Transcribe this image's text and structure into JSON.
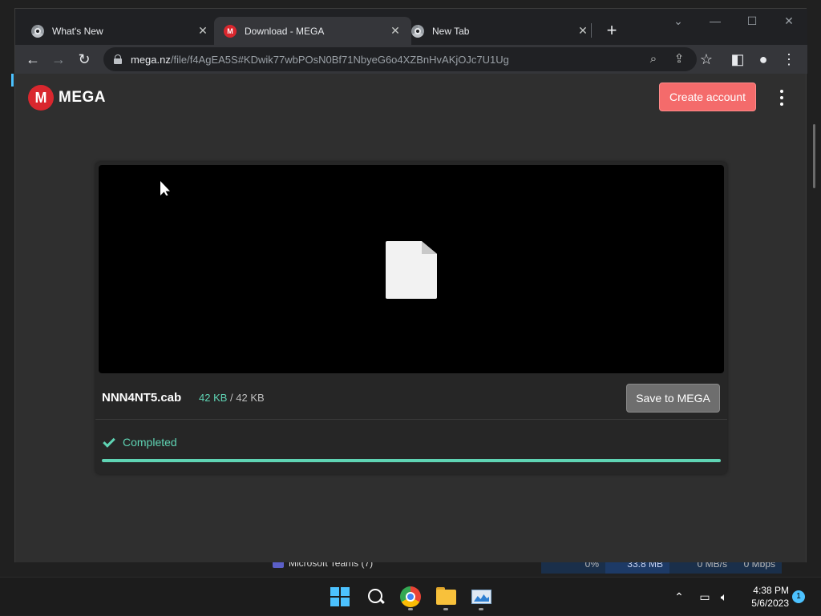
{
  "browser": {
    "tabs": [
      {
        "label": "What's New",
        "active": false,
        "icon": "chrome-icon"
      },
      {
        "label": "Download - MEGA",
        "active": true,
        "icon": "mega-icon"
      },
      {
        "label": "New Tab",
        "active": false,
        "icon": "chrome-icon"
      }
    ],
    "new_tab": "+",
    "url_domain": "mega.nz",
    "url_path": "/file/f4AgEA5S#KDwik77wbPOsN0Bf71NbyeG6o4XZBnHvAKjOJc7U1Ug"
  },
  "mega": {
    "logo_letter": "M",
    "logo_text": "MEGA",
    "create_account_label": "Create account",
    "file_name": "NNN4NT5.cab",
    "size_downloaded": "42 KB",
    "size_separator": "/",
    "size_total": "42 KB",
    "save_label": "Save to MEGA",
    "status_label": "Completed",
    "progress": 1.0,
    "accent_color": "#5fd4b4",
    "brand_color": "#d9272e"
  },
  "background_window": {
    "bottom_row_label": "Microsoft Teams (7)",
    "cpu": "0%",
    "memory": "33.8 MB",
    "disk": "0 MB/s",
    "network": "0 Mbps"
  },
  "taskbar": {
    "time": "4:38 PM",
    "date": "5/6/2023",
    "notification_count": "1"
  }
}
